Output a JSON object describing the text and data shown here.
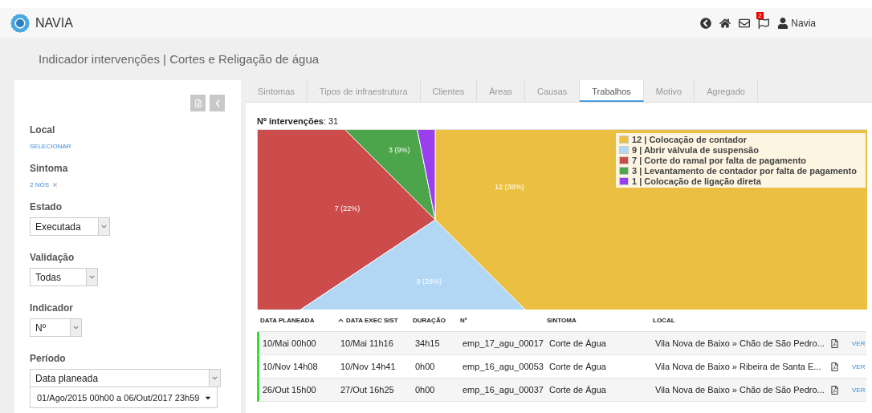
{
  "header": {
    "brand": "NAVIA",
    "notification_count": "2",
    "user": "Navia"
  },
  "page_title": "Indicador intervenções | Cortes e Religação de água",
  "filters": [
    {
      "kind": "link",
      "label": "Local",
      "value": "SELECIONAR"
    },
    {
      "kind": "link",
      "label": "Sintoma",
      "value": "2 NÓS",
      "clearable": true
    },
    {
      "kind": "select",
      "label": "Estado",
      "value": "Executada"
    },
    {
      "kind": "select",
      "label": "Validação",
      "value": "Todas"
    },
    {
      "kind": "select",
      "label": "Indicador",
      "value": "Nº"
    },
    {
      "kind": "period",
      "label": "Período",
      "value": "Data planeada",
      "range": "01/Ago/2015 00h00 a 06/Out/2017 23h59"
    }
  ],
  "tabs": [
    {
      "label": "Sintomas",
      "selected": false
    },
    {
      "label": "Tipos de infraestrutura",
      "selected": false
    },
    {
      "label": "Clientes",
      "selected": false
    },
    {
      "label": "Áreas",
      "selected": false
    },
    {
      "label": "Causas",
      "selected": false
    },
    {
      "label": "Trabalhos",
      "selected": true
    },
    {
      "label": "Motivo",
      "selected": false
    },
    {
      "label": "Agregado",
      "selected": false
    }
  ],
  "summary": "**Nº intervenções**: 31",
  "chart_data": {
    "type": "pie",
    "categories": [
      "12 | Colocação de contador",
      "9 | Abrir válvula de suspensão",
      "7 | Corte do ramal por falta de pagamento",
      "3 | Levantamento de contador por falta de pagamento",
      "1 | Colocação de ligação direta"
    ],
    "values": [
      12,
      9,
      7,
      3,
      1
    ],
    "colors": [
      "#ebc042",
      "#b2d7f5",
      "#cc4b4b",
      "#4da54b",
      "#9a3ff0"
    ],
    "value_labels": [
      "12 (38%)",
      "9 (28%)",
      "7 (22%)",
      "3 (9%)",
      null
    ]
  },
  "table": {
    "columns": [
      {
        "label": "DATA PLANEADA",
        "sorted": false
      },
      {
        "label": "DATA EXEC SIST",
        "sorted": true
      },
      {
        "label": "DURAÇÃO",
        "sorted": false
      },
      {
        "label": "Nº",
        "sorted": false
      },
      {
        "label": "SINTOMA",
        "sorted": false
      },
      {
        "label": "LOCAL",
        "sorted": false
      }
    ],
    "actions": [
      "VER",
      "VER",
      "VER"
    ],
    "rows": [
      [
        "10/Mai 00h00",
        "10/Mai 11h16",
        "34h15",
        "emp_17_agu_00017",
        "Corte de Água",
        "Vila Nova de Baixo » Chão de São Pedro..."
      ],
      [
        "10/Nov 14h08",
        "10/Nov 14h41",
        "0h00",
        "emp_16_agu_00053",
        "Corte de Água",
        "Vila Nova de Baixo » Ribeira de Santa E..."
      ],
      [
        "26/Out 15h00",
        "27/Out 16h25",
        "0h00",
        "emp_16_agu_00037",
        "Corte de Água",
        "Vila Nova de Baixo » Chão de São Pedro..."
      ]
    ]
  }
}
